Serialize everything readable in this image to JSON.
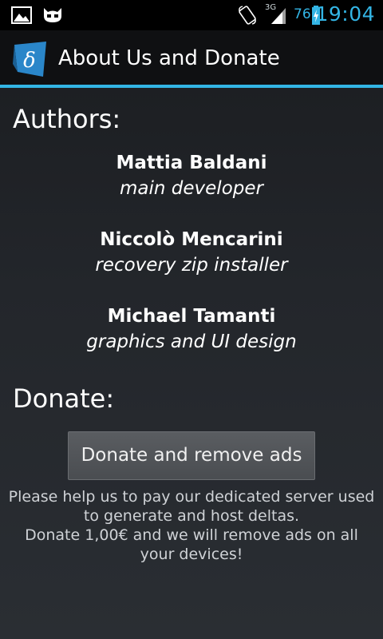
{
  "status_bar": {
    "network": "3G",
    "battery_level": "76",
    "time": "19:04",
    "accent_color": "#33b5e5",
    "icons": [
      "gallery-icon",
      "cyanogen-icon",
      "rotate-icon",
      "signal-icon",
      "battery-charging-icon"
    ]
  },
  "action_bar": {
    "title": "About Us and Donate",
    "app_icon": "delta-app-icon",
    "divider_color": "#33b5e5"
  },
  "authors": {
    "heading": "Authors:",
    "list": [
      {
        "name": "Mattia Baldani",
        "role": "main developer"
      },
      {
        "name": "Niccolò Mencarini",
        "role": "recovery zip installer"
      },
      {
        "name": "Michael Tamanti",
        "role": "graphics and UI design"
      }
    ]
  },
  "donate": {
    "heading": "Donate:",
    "button_label": "Donate and remove ads",
    "description_lines": [
      "Please help us to pay our dedicated server used",
      "to generate and host deltas.",
      "Donate 1,00€ and we will remove ads on all",
      "your devices!"
    ]
  }
}
